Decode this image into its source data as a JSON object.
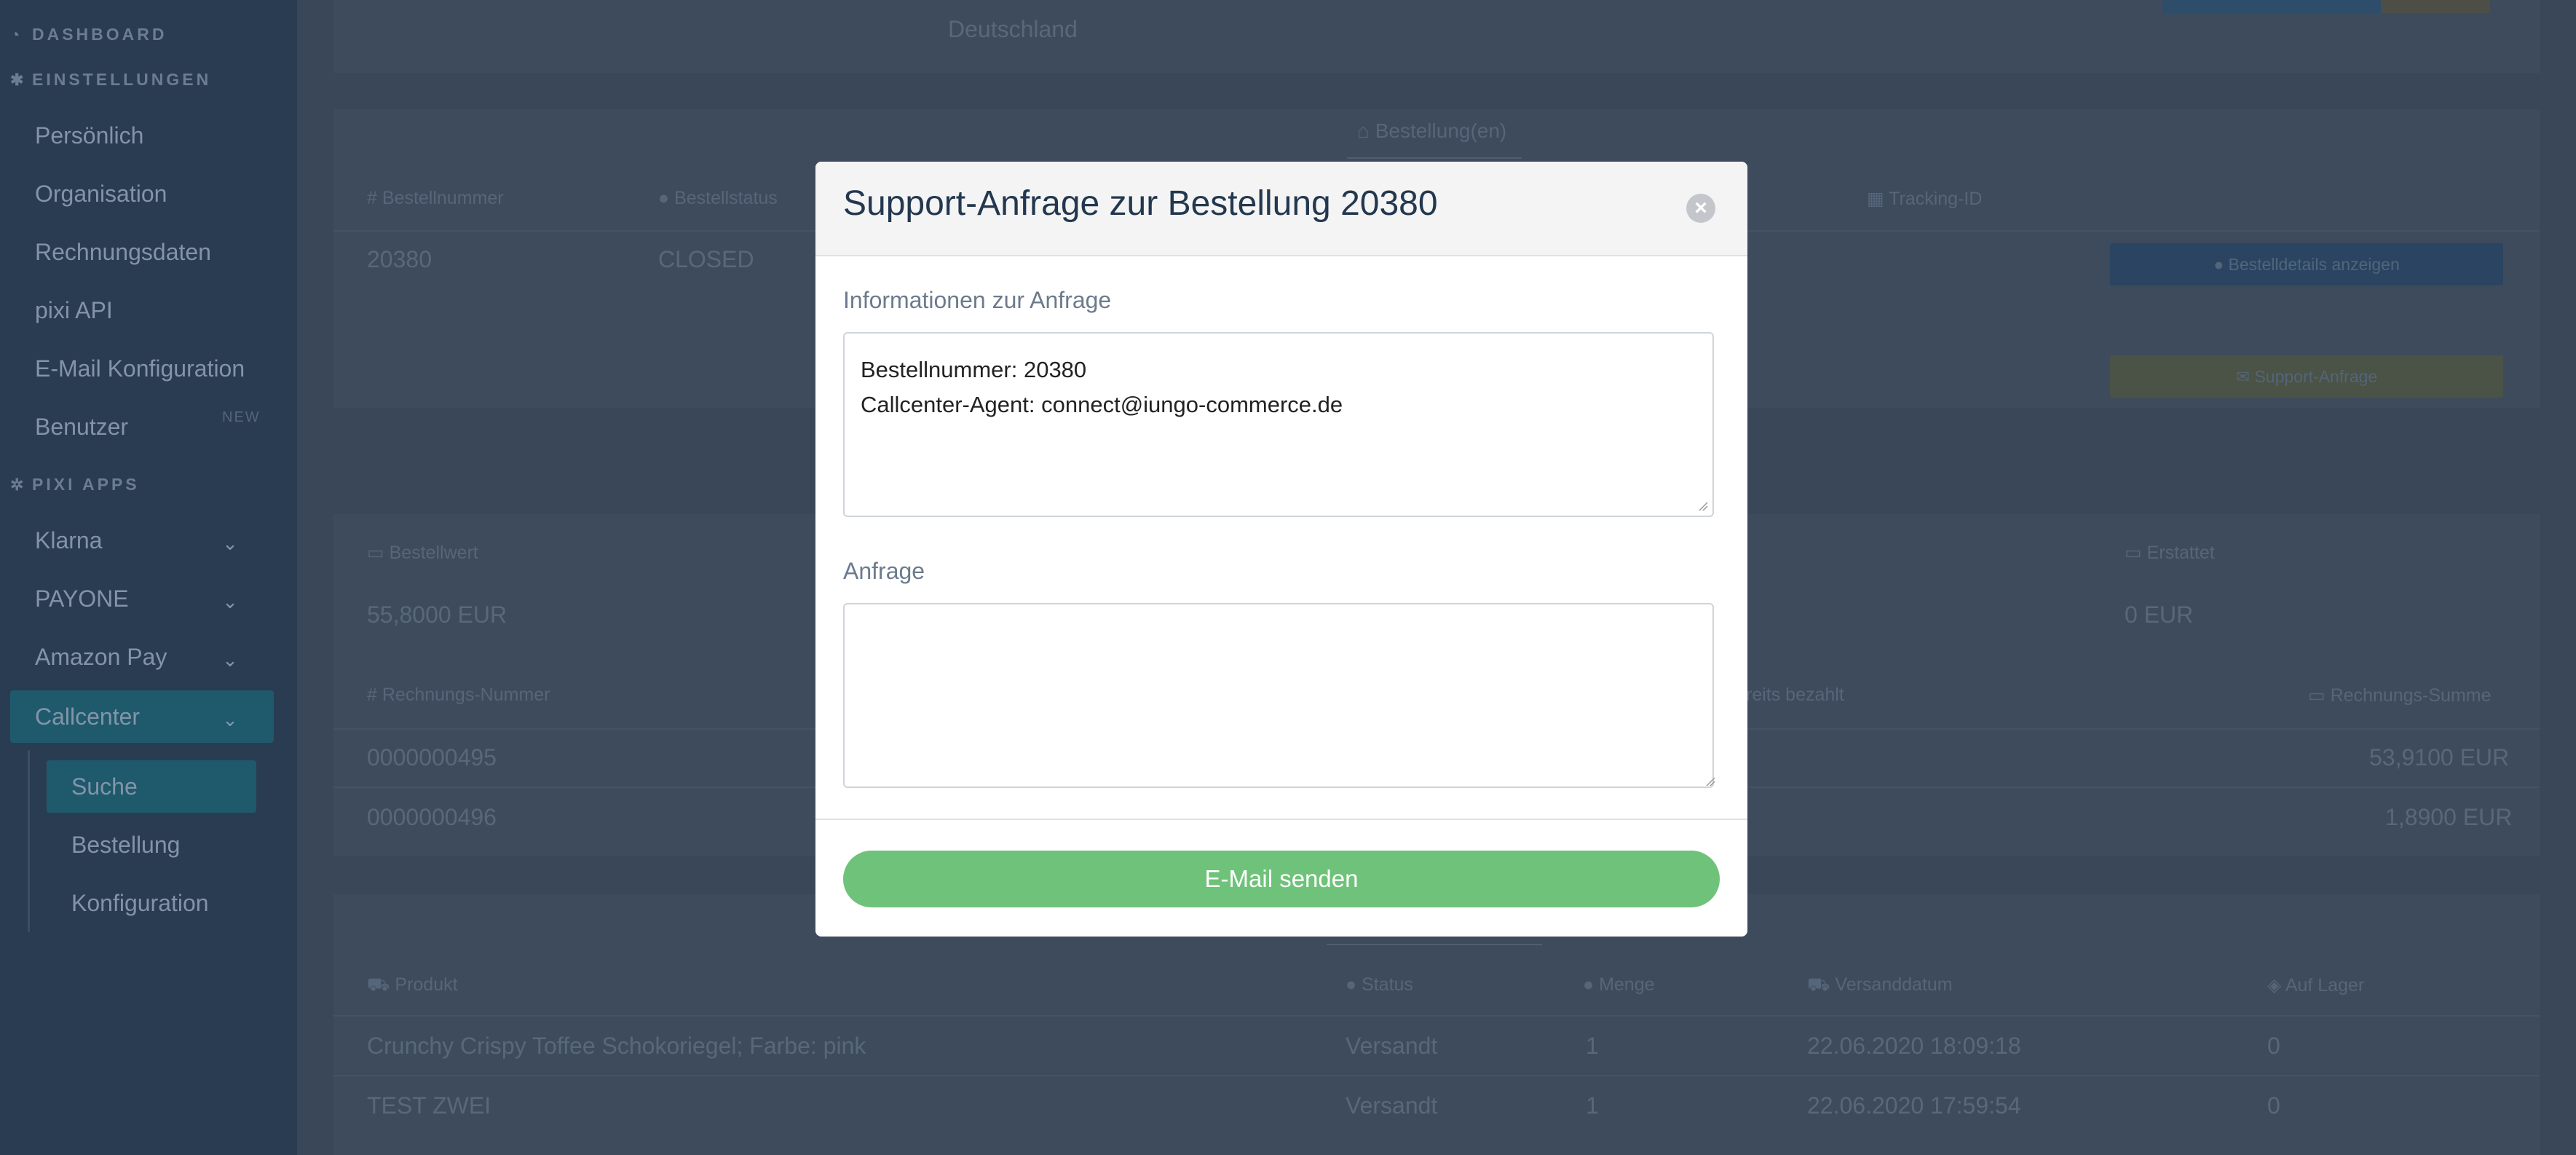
{
  "sidebar": {
    "sections": {
      "dashboard": "DASHBOARD",
      "einstellungen": "EINSTELLUNGEN",
      "pixi_apps": "PIXI APPS"
    },
    "settings_items": [
      "Persönlich",
      "Organisation",
      "Rechnungsdaten",
      "pixi API",
      "E-Mail Konfiguration",
      "Benutzer"
    ],
    "new_badge": "NEW",
    "app_items": [
      "Klarna",
      "PAYONE",
      "Amazon Pay",
      "Callcenter"
    ],
    "callcenter_sub": [
      "Suche",
      "Bestellung",
      "Konfiguration"
    ]
  },
  "background": {
    "address_line": "Deutschland",
    "orders_tab": "Bestellung(en)",
    "order_headers": {
      "number": "Bestellnummer",
      "status": "Bestellstatus",
      "tracking": "Tracking-ID"
    },
    "order_row": {
      "number": "20380",
      "status": "CLOSED"
    },
    "details_button": "Bestelldetails anzeigen",
    "support_button": "Support-Anfrage",
    "value_headers": {
      "value": "Bestellwert",
      "refunded": "Erstattet"
    },
    "value_row": {
      "value": "55,8000 EUR",
      "refunded": "0 EUR"
    },
    "invoice_headers": {
      "number": "Rechnungs-Nummer",
      "paid": "reits bezahlt",
      "sum": "Rechnungs-Summe"
    },
    "invoices": [
      {
        "number": "0000000495",
        "sum": "53,9100 EUR"
      },
      {
        "number": "0000000496",
        "sum": "1,8900 EUR"
      }
    ],
    "product_headers": {
      "product": "Produkt",
      "status": "Status",
      "qty": "Menge",
      "ship_date": "Versanddatum",
      "stock": "Auf Lager"
    },
    "products": [
      {
        "name": "Crunchy Crispy Toffee Schokoriegel; Farbe: pink",
        "status": "Versandt",
        "qty": "1",
        "date": "22.06.2020 18:09:18",
        "stock": "0"
      },
      {
        "name": "TEST ZWEI",
        "status": "Versandt",
        "qty": "1",
        "date": "22.06.2020 17:59:54",
        "stock": "0"
      }
    ]
  },
  "modal": {
    "title": "Support-Anfrage zur Bestellung 20380",
    "info_label": "Informationen zur Anfrage",
    "info_line1": "Bestellnummer: 20380",
    "info_line2": "Callcenter-Agent: connect@iungo-commerce.de",
    "request_label": "Anfrage",
    "request_value": "",
    "send_button": "E-Mail senden"
  },
  "colors": {
    "sidebar_bg": "#2a3c52",
    "active_item": "#1e5a6b",
    "send_button": "#6fc27a",
    "modal_title": "#23384f"
  }
}
